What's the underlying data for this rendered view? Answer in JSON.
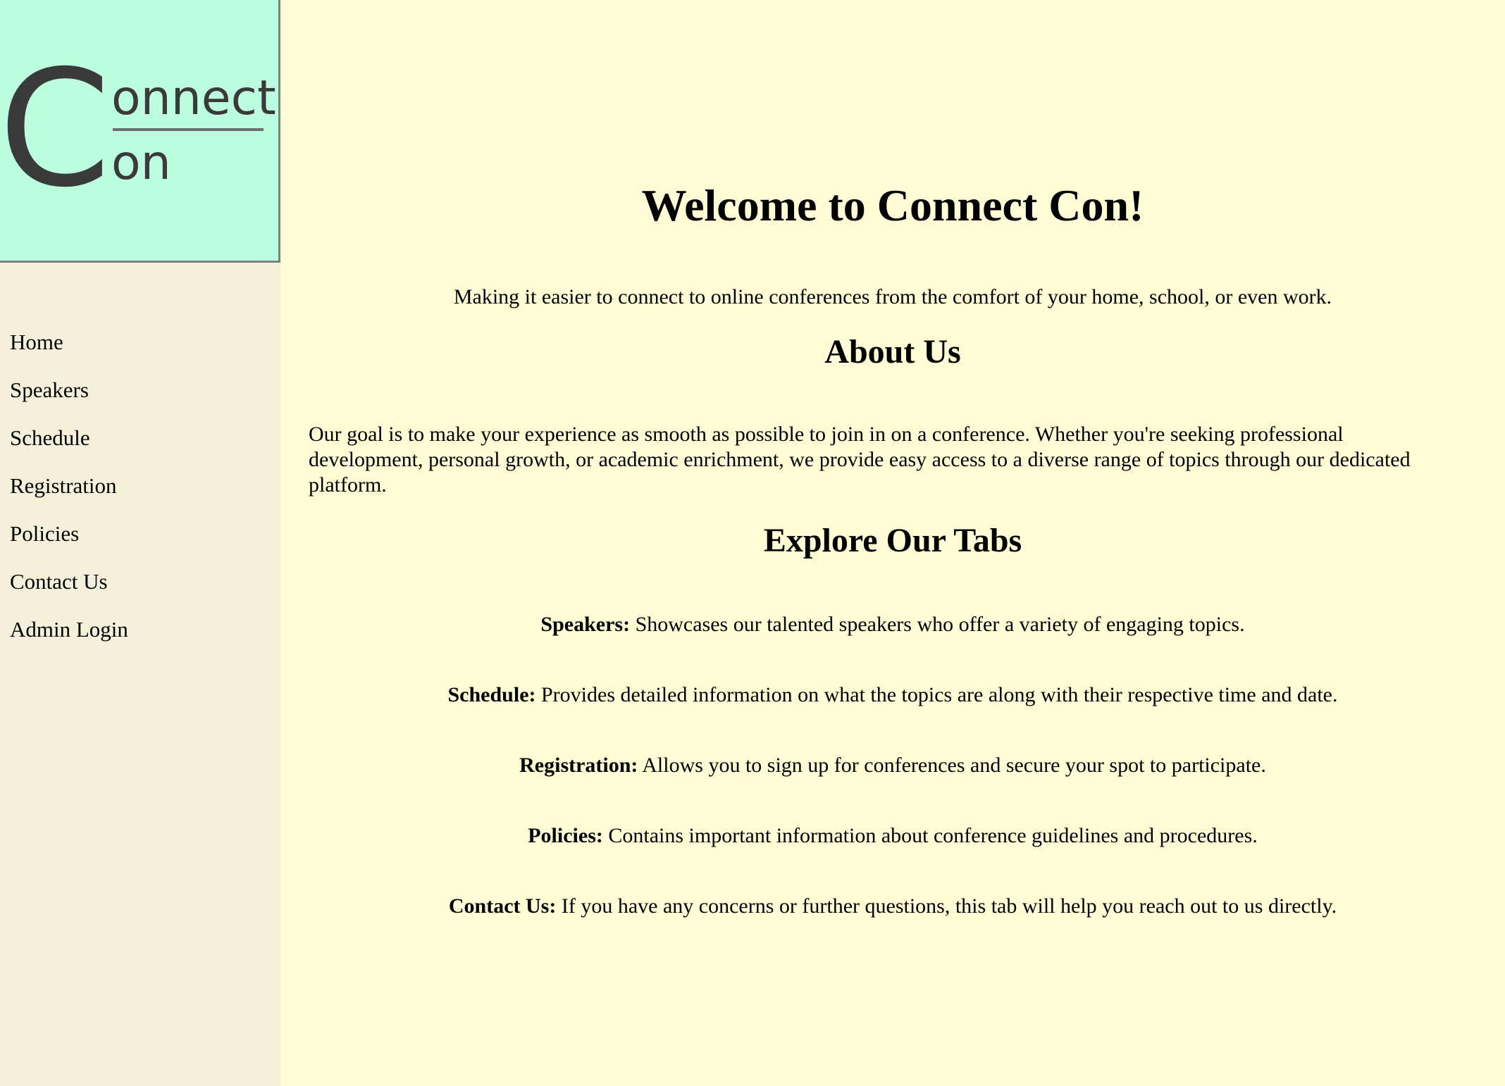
{
  "logo": {
    "big_letter": "C",
    "top_text": "onnect",
    "bottom_text": "on"
  },
  "sidebar": {
    "items": [
      {
        "label": "Home"
      },
      {
        "label": "Speakers"
      },
      {
        "label": "Schedule"
      },
      {
        "label": "Registration"
      },
      {
        "label": "Policies"
      },
      {
        "label": "Contact Us"
      },
      {
        "label": "Admin Login"
      }
    ]
  },
  "main": {
    "title": "Welcome to Connect Con!",
    "tagline": "Making it easier to connect to online conferences from the comfort of your home, school, or even work.",
    "about_heading": "About Us",
    "about_text": "Our goal is to make your experience as smooth as possible to join in on a conference. Whether you're seeking professional development, personal growth, or academic enrichment, we provide easy access to a diverse range of topics through our dedicated platform.",
    "explore_heading": "Explore Our Tabs",
    "tabs": [
      {
        "name": "Speakers:",
        "desc": " Showcases our talented speakers who offer a variety of engaging topics."
      },
      {
        "name": "Schedule:",
        "desc": " Provides detailed information on what the topics are along with their respective time and date."
      },
      {
        "name": "Registration:",
        "desc": " Allows you to sign up for conferences and secure your spot to participate."
      },
      {
        "name": "Policies:",
        "desc": " Contains important information about conference guidelines and procedures."
      },
      {
        "name": "Contact Us:",
        "desc": " If you have any concerns or further questions, this tab will help you reach out to us directly."
      }
    ]
  },
  "colors": {
    "page_background": "#FFFCD6",
    "sidebar_background": "#F5F0DA",
    "logo_background": "#BCFEE0",
    "logo_text": "#3A3A3A"
  }
}
